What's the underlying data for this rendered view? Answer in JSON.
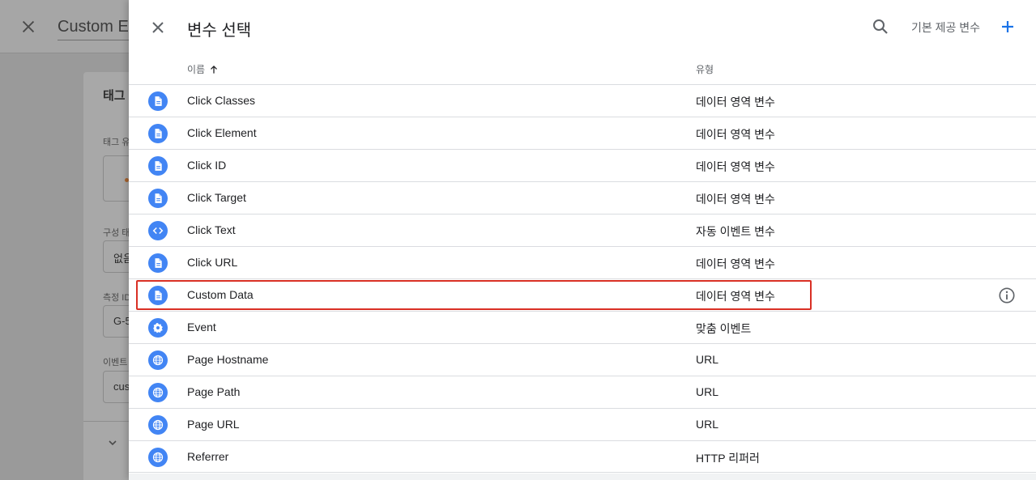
{
  "background": {
    "title": "Custom Ev",
    "card_title": "태그",
    "labels": [
      "태그 유",
      "구성 태",
      "측정 ID",
      "이벤트"
    ],
    "field_values": [
      "없음",
      "G-5",
      "cus"
    ]
  },
  "panel": {
    "title": "변수 선택",
    "builtin_label": "기본 제공 변수",
    "columns": {
      "name": "이름",
      "type": "유형"
    }
  },
  "rows": [
    {
      "name": "Click Classes",
      "type": "데이터 영역 변수",
      "icon": "document-icon"
    },
    {
      "name": "Click Element",
      "type": "데이터 영역 변수",
      "icon": "document-icon"
    },
    {
      "name": "Click ID",
      "type": "데이터 영역 변수",
      "icon": "document-icon"
    },
    {
      "name": "Click Target",
      "type": "데이터 영역 변수",
      "icon": "document-icon"
    },
    {
      "name": "Click Text",
      "type": "자동 이벤트 변수",
      "icon": "code-icon"
    },
    {
      "name": "Click URL",
      "type": "데이터 영역 변수",
      "icon": "document-icon"
    },
    {
      "name": "Custom Data",
      "type": "데이터 영역 변수",
      "icon": "document-icon",
      "highlighted": true
    },
    {
      "name": "Event",
      "type": "맞춤 이벤트",
      "icon": "gear-icon"
    },
    {
      "name": "Page Hostname",
      "type": "URL",
      "icon": "globe-icon"
    },
    {
      "name": "Page Path",
      "type": "URL",
      "icon": "globe-icon"
    },
    {
      "name": "Page URL",
      "type": "URL",
      "icon": "globe-icon"
    },
    {
      "name": "Referrer",
      "type": "HTTP 리퍼러",
      "icon": "globe-icon"
    }
  ],
  "colors": {
    "accent": "#1a73e8",
    "icon_circle": "#4285f4",
    "highlight": "#d93025"
  }
}
